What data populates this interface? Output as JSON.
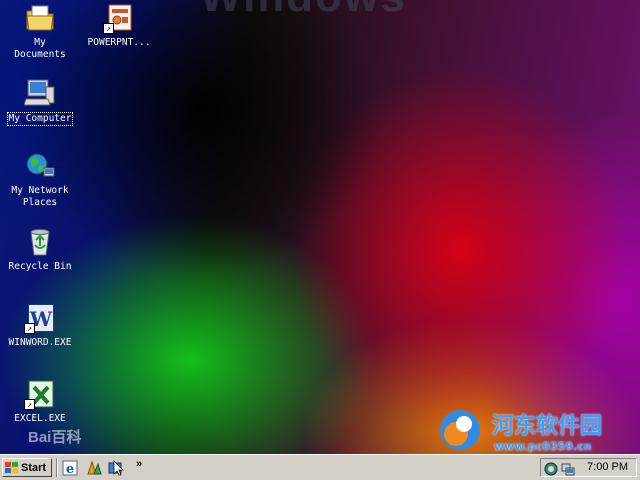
{
  "desktop": {
    "wallpaper_logo": "Windows",
    "icons": [
      {
        "label": "My\nDocuments",
        "icon": "my-documents-icon"
      },
      {
        "label": "POWERPNT...",
        "icon": "powerpoint-icon"
      },
      {
        "label": "My Computer",
        "icon": "my-computer-icon"
      },
      {
        "label": "My Network\nPlaces",
        "icon": "network-places-icon"
      },
      {
        "label": "Recycle Bin",
        "icon": "recycle-bin-icon"
      },
      {
        "label": "WINWORD.EXE",
        "icon": "word-icon"
      },
      {
        "label": "EXCEL.EXE",
        "icon": "excel-icon"
      }
    ]
  },
  "watermarks": {
    "baidu": "Bai百科",
    "site_title": "河东软件园",
    "site_url": "www.pc0359.cn"
  },
  "taskbar": {
    "start_label": "Start",
    "quick_launch": [
      "ie-icon",
      "media-player-icon",
      "desktop-icon"
    ],
    "chevron": "»",
    "tray": {
      "icons": [
        "volume-icon",
        "network-icon"
      ],
      "clock": "7:00 PM"
    }
  }
}
